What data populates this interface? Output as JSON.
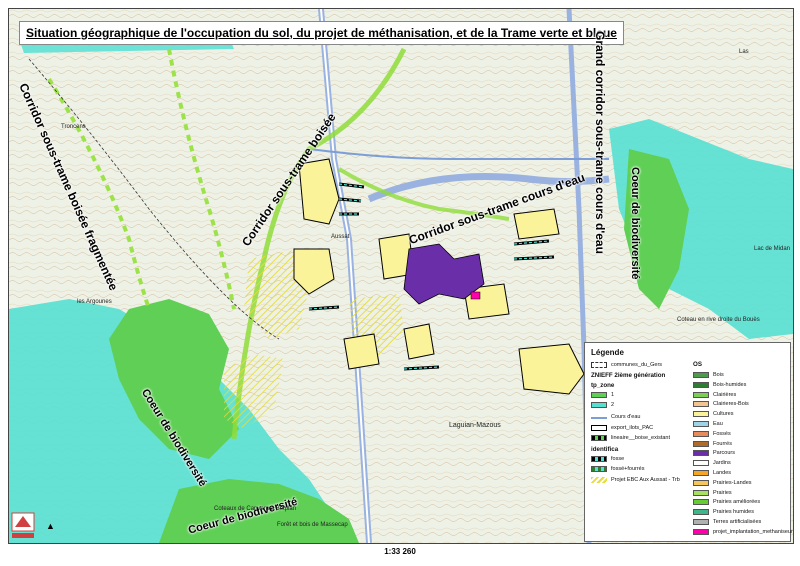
{
  "title": "Situation géographique de l'occupation du sol, du projet de méthanisation, et de la Trame verte et bleue",
  "scale_label": "1:33 260",
  "corridor_labels": {
    "boisee_fragmentee": "Corridor sous-trame boisée fragmentée",
    "sous_trame_boisee": "Corridor sous-trame boisée",
    "cours_deau": "Corridor sous-trame cours d'eau",
    "grand_corridor": "Grand corridor sous-trame cours d'eau",
    "coeur_right": "Coeur de biodiversité",
    "coeur_left": "Coeur de biodiversité",
    "coeur_bottom": "Coeur de biodiversité"
  },
  "place_names": {
    "argounes": "les Argounes",
    "aussat": "Aussat",
    "coteaux": "Coteaux de Capvern à Betplan",
    "foret": "Forêt et bois de Massecap",
    "laguian": "Laguian-Mazous",
    "midan": "Lac de Midan",
    "coteau_rive": "Coteau en rive droite du Bouès",
    "froncens": "Troncens",
    "las": "Las"
  },
  "legend": {
    "title": "Légende",
    "communes": "communes_du_Gers",
    "znieff": "ZNIEFF 2ième génération",
    "tp_zone": "tp_zone",
    "zone_1": "1",
    "zone_2": "2",
    "cours_deau": "Cours d'eau",
    "export_pac": "export_ilots_PAC",
    "lineaire": "lineaire__boise_existant",
    "identifica": "identifica",
    "fosse": "fosse",
    "fosse_fourres": "fossé+fourrés",
    "projet_ebc": "Projet EBC Aux Aussat - Trb",
    "os_heading": "OS",
    "os_items": [
      {
        "label": "Bois",
        "color": "#4e9a4e"
      },
      {
        "label": "Bois-humides",
        "color": "#2e7d32"
      },
      {
        "label": "Clairières",
        "color": "#7ccf55"
      },
      {
        "label": "Clairieres-Bois",
        "color": "#f3c48f"
      },
      {
        "label": "Cultures",
        "color": "#fbf39a"
      },
      {
        "label": "Eau",
        "color": "#9fd3e8"
      },
      {
        "label": "Fossés",
        "color": "#e88b5b"
      },
      {
        "label": "Fourrés",
        "color": "#b06a2a"
      },
      {
        "label": "Parcours",
        "color": "#6a2fa8"
      },
      {
        "label": "Jardins",
        "color": "#ffffff"
      },
      {
        "label": "Landes",
        "color": "#f5a623"
      },
      {
        "label": "Prairies-Landes",
        "color": "#f7c65a"
      },
      {
        "label": "Prairies",
        "color": "#a8e05f"
      },
      {
        "label": "Prairies améliorées",
        "color": "#66cc33"
      },
      {
        "label": "Prairies humides",
        "color": "#3fb58a"
      },
      {
        "label": "Terres artificialisées",
        "color": "#b0b0b0"
      },
      {
        "label": "projet_implantation_methaniseur",
        "color": "#ff00aa"
      }
    ]
  },
  "colors": {
    "corridor_green": "#8fdc3a",
    "znieff_cyan": "#55e0d2",
    "coeur_green": "#5fcf55",
    "road_blue": "#9ab2e0",
    "cultures_yellow": "#fbf39a",
    "parcours_purple": "#6a2fa8"
  }
}
